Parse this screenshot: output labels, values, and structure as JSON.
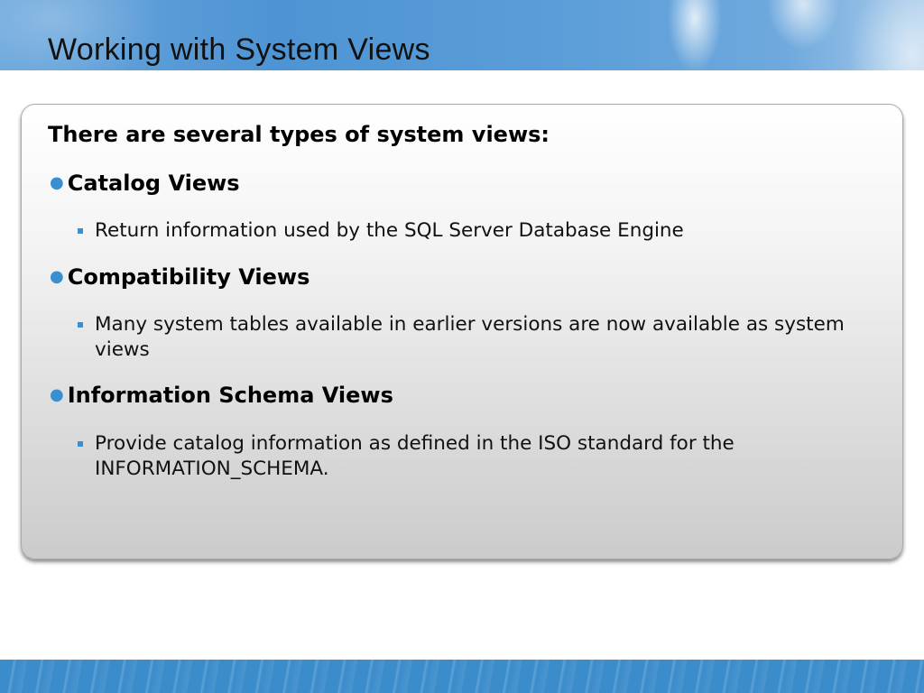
{
  "slide": {
    "title": "Working with System Views",
    "intro": "There are several types of system views:",
    "items": [
      {
        "heading": "Catalog Views",
        "detail": "Return information used by the SQL Server Database Engine"
      },
      {
        "heading": "Compatibility Views",
        "detail": "Many system tables available in earlier versions are now available as system views"
      },
      {
        "heading": "Information Schema Views",
        "detail": "Provide catalog information as defined in the ISO standard for the INFORMATION_SCHEMA."
      }
    ]
  },
  "colors": {
    "accent": "#3a8fd0",
    "band": "#4e94d4"
  }
}
